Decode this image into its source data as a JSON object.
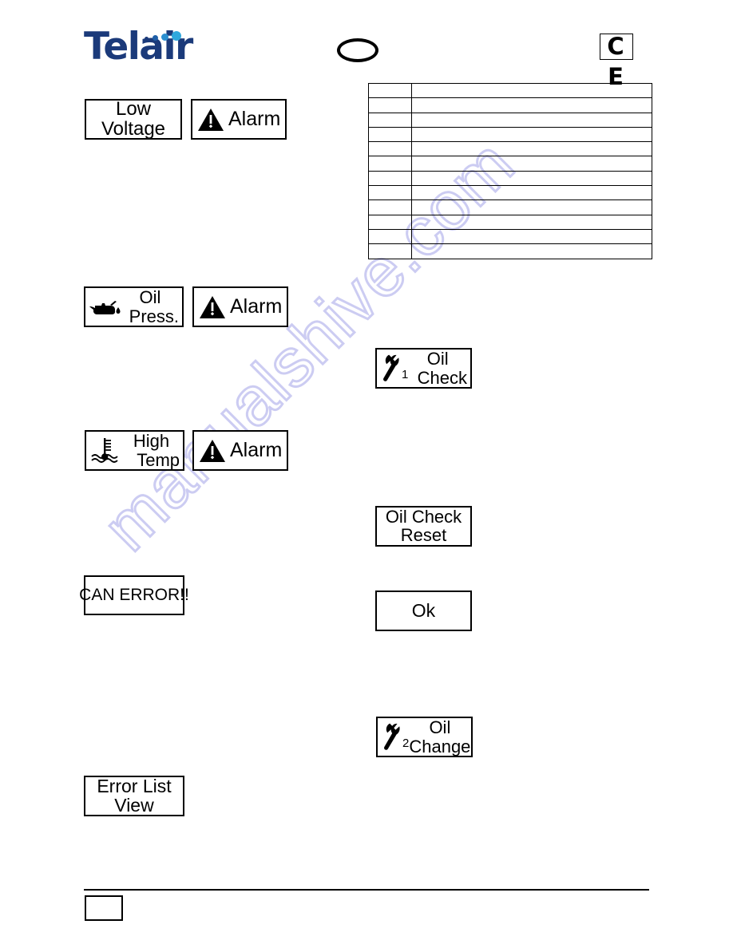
{
  "header": {
    "logo_text": "Telair",
    "logo_dots_icon": "four-dots-icon",
    "ellipse_mark_icon": "ellipse-outline-icon",
    "ce_mark_text": "C E"
  },
  "watermark": {
    "text": "manualshive.com",
    "color": "#ccccf2"
  },
  "left_column": {
    "low_voltage_box": {
      "line1": "Low",
      "line2": "Voltage"
    },
    "alarm_box_1": {
      "icon": "warning-triangle-icon",
      "label": "Alarm"
    },
    "oil_press_box": {
      "icon": "oil-can-icon",
      "line1": "Oil",
      "line2": "Press."
    },
    "alarm_box_2": {
      "icon": "warning-triangle-icon",
      "label": "Alarm"
    },
    "high_temp_box": {
      "icon": "thermometer-water-icon",
      "line1": "High",
      "line2": "Temp"
    },
    "alarm_box_3": {
      "icon": "warning-triangle-icon",
      "label": "Alarm"
    },
    "can_error_box": {
      "text": "CAN ERROR!!"
    },
    "error_list_box": {
      "line1": "Error  List",
      "line2": "View"
    }
  },
  "right_column": {
    "oil_check_box": {
      "icon": "wrench-icon",
      "number": "1",
      "line1": "Oil",
      "line2": "Check"
    },
    "oil_check_reset_box": {
      "line1": "Oil Check",
      "line2": "Reset"
    },
    "ok_box": {
      "label": "Ok"
    },
    "oil_change_box": {
      "icon": "wrench-icon",
      "number": "2",
      "line1": "Oil",
      "line2": "Change"
    }
  },
  "spec_table": {
    "row_count": 12,
    "col_count": 2,
    "rows": [
      [
        "",
        ""
      ],
      [
        "",
        ""
      ],
      [
        "",
        ""
      ],
      [
        "",
        ""
      ],
      [
        "",
        ""
      ],
      [
        "",
        ""
      ],
      [
        "",
        ""
      ],
      [
        "",
        ""
      ],
      [
        "",
        ""
      ],
      [
        "",
        ""
      ],
      [
        "",
        ""
      ],
      [
        "",
        ""
      ]
    ]
  },
  "footer": {
    "page_box_text": ""
  }
}
